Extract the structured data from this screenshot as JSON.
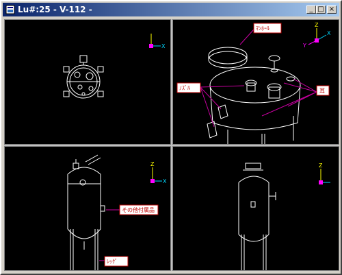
{
  "window": {
    "title": "Lu#:25 - V-112 -",
    "buttons": {
      "minimize": "_",
      "maximize": "□",
      "close": "×"
    }
  },
  "views": {
    "top": {
      "axis_x": "X",
      "axis_y": ""
    },
    "iso": {
      "axis_x": "X",
      "axis_y": "Y",
      "axis_z": "Z",
      "label_manhole": "ﾏﾝﾎｰﾙ",
      "label_nozzle": "ﾉｽﾞﾙ",
      "label_ear": "耳"
    },
    "front": {
      "axis_x": "X",
      "axis_z": "Z",
      "label_other": "その他付属品",
      "label_legs": "ﾚｯｸﾞ"
    },
    "side": {
      "axis_z": "Z"
    }
  },
  "colors": {
    "titlebar": "#0a246a",
    "viewport_bg": "#000000",
    "geometry": "#ffffff",
    "label_border": "#c00000",
    "iso_arrow": "#c800a0",
    "axis_x": "#00d8ff",
    "axis_y": "#ffff00",
    "axis_z": "#ff00ff"
  }
}
